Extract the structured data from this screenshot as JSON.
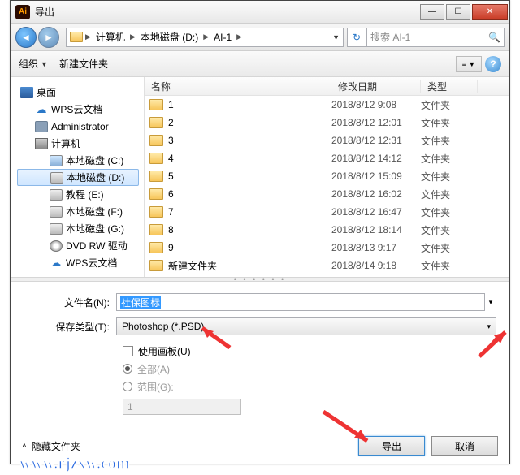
{
  "titlebar": {
    "app_icon_text": "Ai",
    "title": "导出"
  },
  "nav": {
    "breadcrumb": [
      "计算机",
      "本地磁盘 (D:)",
      "AI-1"
    ],
    "search_placeholder": "搜索 AI-1"
  },
  "toolbar": {
    "organize": "组织",
    "new_folder": "新建文件夹"
  },
  "sidebar": {
    "desktop": "桌面",
    "wps": "WPS云文档",
    "admin": "Administrator",
    "computer": "计算机",
    "drives": [
      "本地磁盘 (C:)",
      "本地磁盘 (D:)",
      "教程 (E:)",
      "本地磁盘 (F:)",
      "本地磁盘 (G:)",
      "DVD RW 驱动",
      "WPS云文档"
    ],
    "selected_index": 1
  },
  "file_header": {
    "name": "名称",
    "date": "修改日期",
    "type": "类型"
  },
  "files": [
    {
      "name": "1",
      "date": "2018/8/12 9:08",
      "type": "文件夹"
    },
    {
      "name": "2",
      "date": "2018/8/12 12:01",
      "type": "文件夹"
    },
    {
      "name": "3",
      "date": "2018/8/12 12:31",
      "type": "文件夹"
    },
    {
      "name": "4",
      "date": "2018/8/12 14:12",
      "type": "文件夹"
    },
    {
      "name": "5",
      "date": "2018/8/12 15:09",
      "type": "文件夹"
    },
    {
      "name": "6",
      "date": "2018/8/12 16:02",
      "type": "文件夹"
    },
    {
      "name": "7",
      "date": "2018/8/12 16:47",
      "type": "文件夹"
    },
    {
      "name": "8",
      "date": "2018/8/12 18:14",
      "type": "文件夹"
    },
    {
      "name": "9",
      "date": "2018/8/13 9:17",
      "type": "文件夹"
    },
    {
      "name": "新建文件夹",
      "date": "2018/8/14 9:18",
      "type": "文件夹"
    }
  ],
  "form": {
    "filename_label": "文件名(N):",
    "filename_value": "社保图标",
    "filetype_label": "保存类型(T):",
    "filetype_value": "Photoshop (*.PSD)",
    "use_artboards": "使用画板(U)",
    "all": "全部(A)",
    "range": "范围(G):",
    "range_value": "1"
  },
  "footer": {
    "hide_folders": "隐藏文件夹",
    "export": "导出",
    "cancel": "取消"
  },
  "watermark": "www.rjzxw.com"
}
